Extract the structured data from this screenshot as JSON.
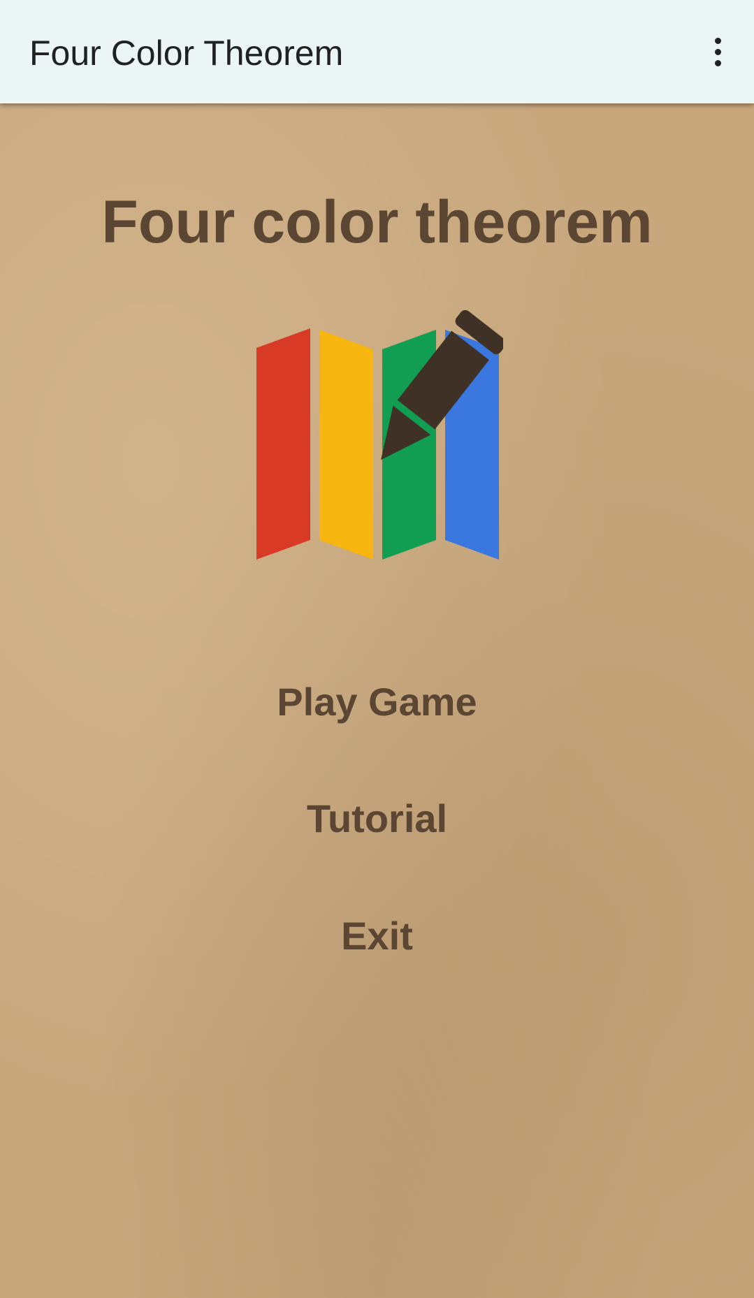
{
  "app_bar": {
    "title": "Four Color Theorem",
    "menu_icon": "more-vert-icon"
  },
  "main": {
    "heading": "Four color theorem",
    "logo": {
      "icon": "map-with-pencil-icon",
      "strip_colors": [
        "#d93a25",
        "#f6b50f",
        "#119d52",
        "#3a78e0"
      ],
      "pencil_color": "#3f3126"
    },
    "menu": {
      "play_label": "Play Game",
      "tutorial_label": "Tutorial",
      "exit_label": "Exit"
    }
  },
  "colors": {
    "app_bar_background": "#ecf6f5",
    "paper_background": "#c8a77d",
    "text_brown": "#5a4632"
  }
}
